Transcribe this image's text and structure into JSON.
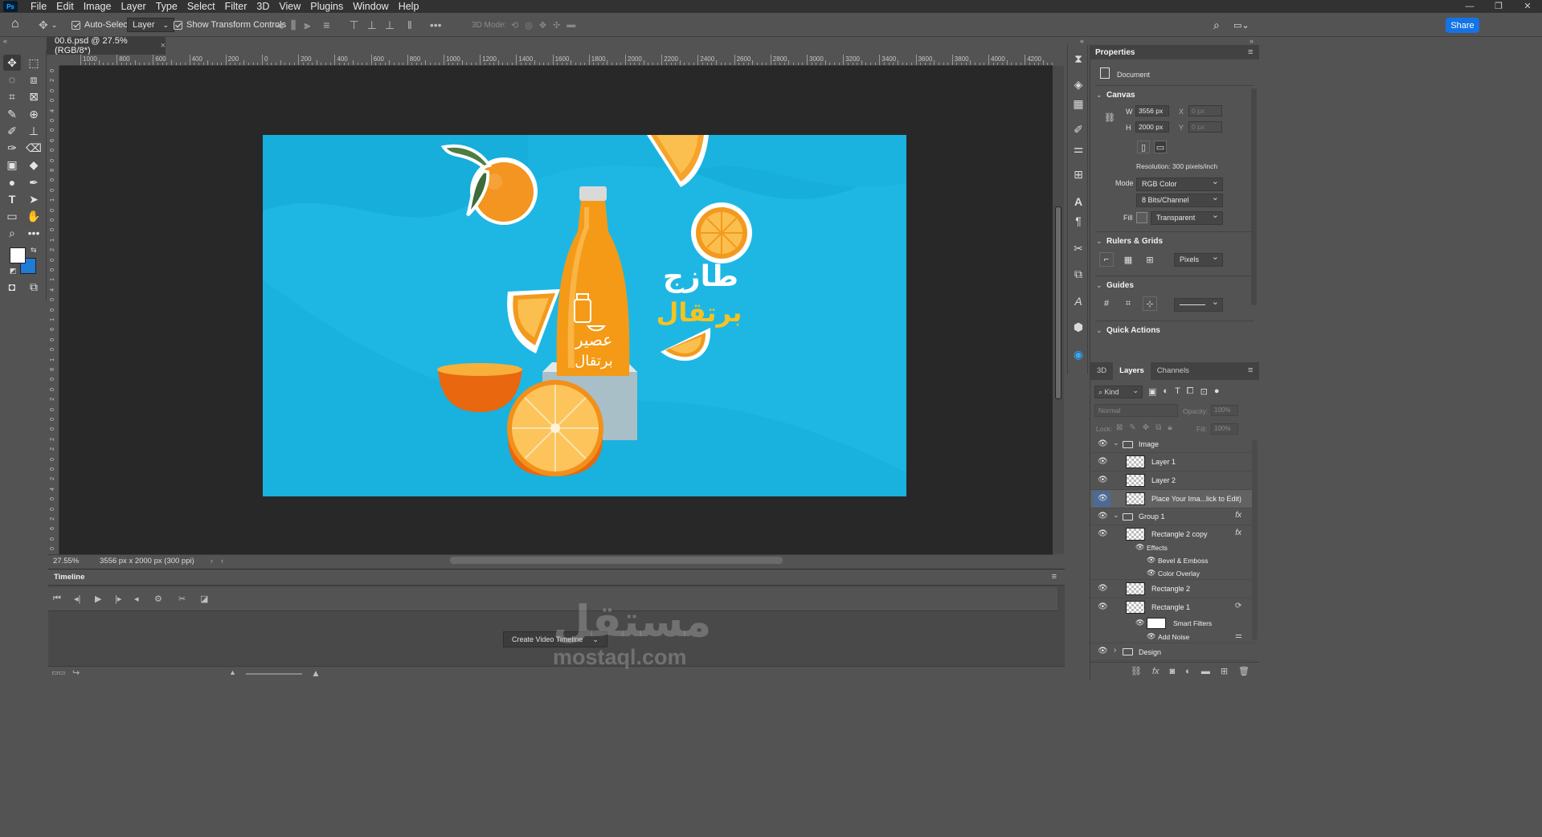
{
  "menu": [
    "File",
    "Edit",
    "Image",
    "Layer",
    "Type",
    "Select",
    "Filter",
    "3D",
    "View",
    "Plugins",
    "Window",
    "Help"
  ],
  "app_badge": "Ps",
  "options_bar": {
    "auto_select_label": "Auto-Select:",
    "auto_select_value": "Layer",
    "show_transform_label": "Show Transform Controls",
    "mode_3d_label": "3D Mode:",
    "share_label": "Share"
  },
  "document_tab": {
    "title": "00.6.psd @ 27.5% (RGB/8*)",
    "close": "×"
  },
  "ruler_top_labels": [
    "1000",
    "800",
    "600",
    "400",
    "200",
    "0",
    "200",
    "400",
    "600",
    "800",
    "1000",
    "1200",
    "1400",
    "1600",
    "1800",
    "2000",
    "2200",
    "2400",
    "2600",
    "2800",
    "3000",
    "3200",
    "3400",
    "3600",
    "3800",
    "4000",
    "4200"
  ],
  "ruler_left_labels": [
    "0",
    "2",
    "0",
    "0",
    "4",
    "0",
    "0",
    "6",
    "0",
    "0",
    "8",
    "0",
    "0",
    "1",
    "0",
    "0",
    "0",
    "1",
    "2",
    "0",
    "0",
    "1",
    "4",
    "0",
    "0",
    "1",
    "6",
    "0",
    "0",
    "1",
    "8",
    "0",
    "0",
    "2",
    "0",
    "0",
    "0",
    "2",
    "2",
    "0",
    "0",
    "2",
    "4",
    "0",
    "0",
    "2",
    "6",
    "0",
    "0"
  ],
  "status_bar": {
    "zoom": "27.55%",
    "doc_info": "3556 px x 2000 px (300 ppi)"
  },
  "artwork": {
    "tagline_top": "طازج",
    "tagline_bottom": "برتقال",
    "bottle_text_1": "عصير",
    "bottle_text_2": "برتقال",
    "background_color": "#1eb7e4",
    "orange_color": "#f29a1e"
  },
  "timeline": {
    "title": "Timeline",
    "create_button": "Create Video Timeline"
  },
  "properties": {
    "title": "Properties",
    "doc_label": "Document",
    "canvas_section": "Canvas",
    "w_label": "W",
    "w_value": "3556 px",
    "h_label": "H",
    "h_value": "2000 px",
    "x_label": "X",
    "x_value": "0 px",
    "y_label": "Y",
    "y_value": "0 px",
    "resolution": "Resolution: 300 pixels/inch",
    "mode_label": "Mode",
    "mode_value": "RGB Color",
    "bits_value": "8 Bits/Channel",
    "fill_label": "Fill",
    "fill_value": "Transparent",
    "rulers_section": "Rulers & Grids",
    "units_value": "Pixels",
    "guides_section": "Guides",
    "quick_actions_section": "Quick Actions"
  },
  "layers_panel": {
    "tabs": [
      "3D",
      "Layers",
      "Channels"
    ],
    "active_tab": "Layers",
    "filter_value": "Kind",
    "blend_value": "Normal",
    "opacity_label": "Opacity:",
    "opacity_value": "100%",
    "lock_label": "Lock:",
    "fill_label": "Fill:",
    "fill_value": "100%",
    "rows": [
      {
        "name": "Image",
        "kind": "group"
      },
      {
        "name": "Layer 1",
        "kind": "layer"
      },
      {
        "name": "Layer 2",
        "kind": "layer"
      },
      {
        "name": "Place Your Ima...lick to Edit)",
        "kind": "smart"
      },
      {
        "name": "Group 1",
        "kind": "group"
      },
      {
        "name": "Rectangle 2 copy",
        "kind": "layer"
      },
      {
        "name": "Effects",
        "kind": "effect-head"
      },
      {
        "name": "Bevel & Emboss",
        "kind": "effect"
      },
      {
        "name": "Color Overlay",
        "kind": "effect"
      },
      {
        "name": "Rectangle 2",
        "kind": "smart"
      },
      {
        "name": "Rectangle 1",
        "kind": "smart"
      },
      {
        "name": "Smart Filters",
        "kind": "filter-head"
      },
      {
        "name": "Add Noise",
        "kind": "effect"
      },
      {
        "name": "Design",
        "kind": "group"
      }
    ],
    "fx_label": "fx"
  },
  "watermark": {
    "arabic": "مستقل",
    "latin": "mostaql.com"
  },
  "colors": {
    "accent": "#1473e6",
    "fg_swatch": "#ffffff",
    "bg_swatch": "#1e7bd6"
  }
}
